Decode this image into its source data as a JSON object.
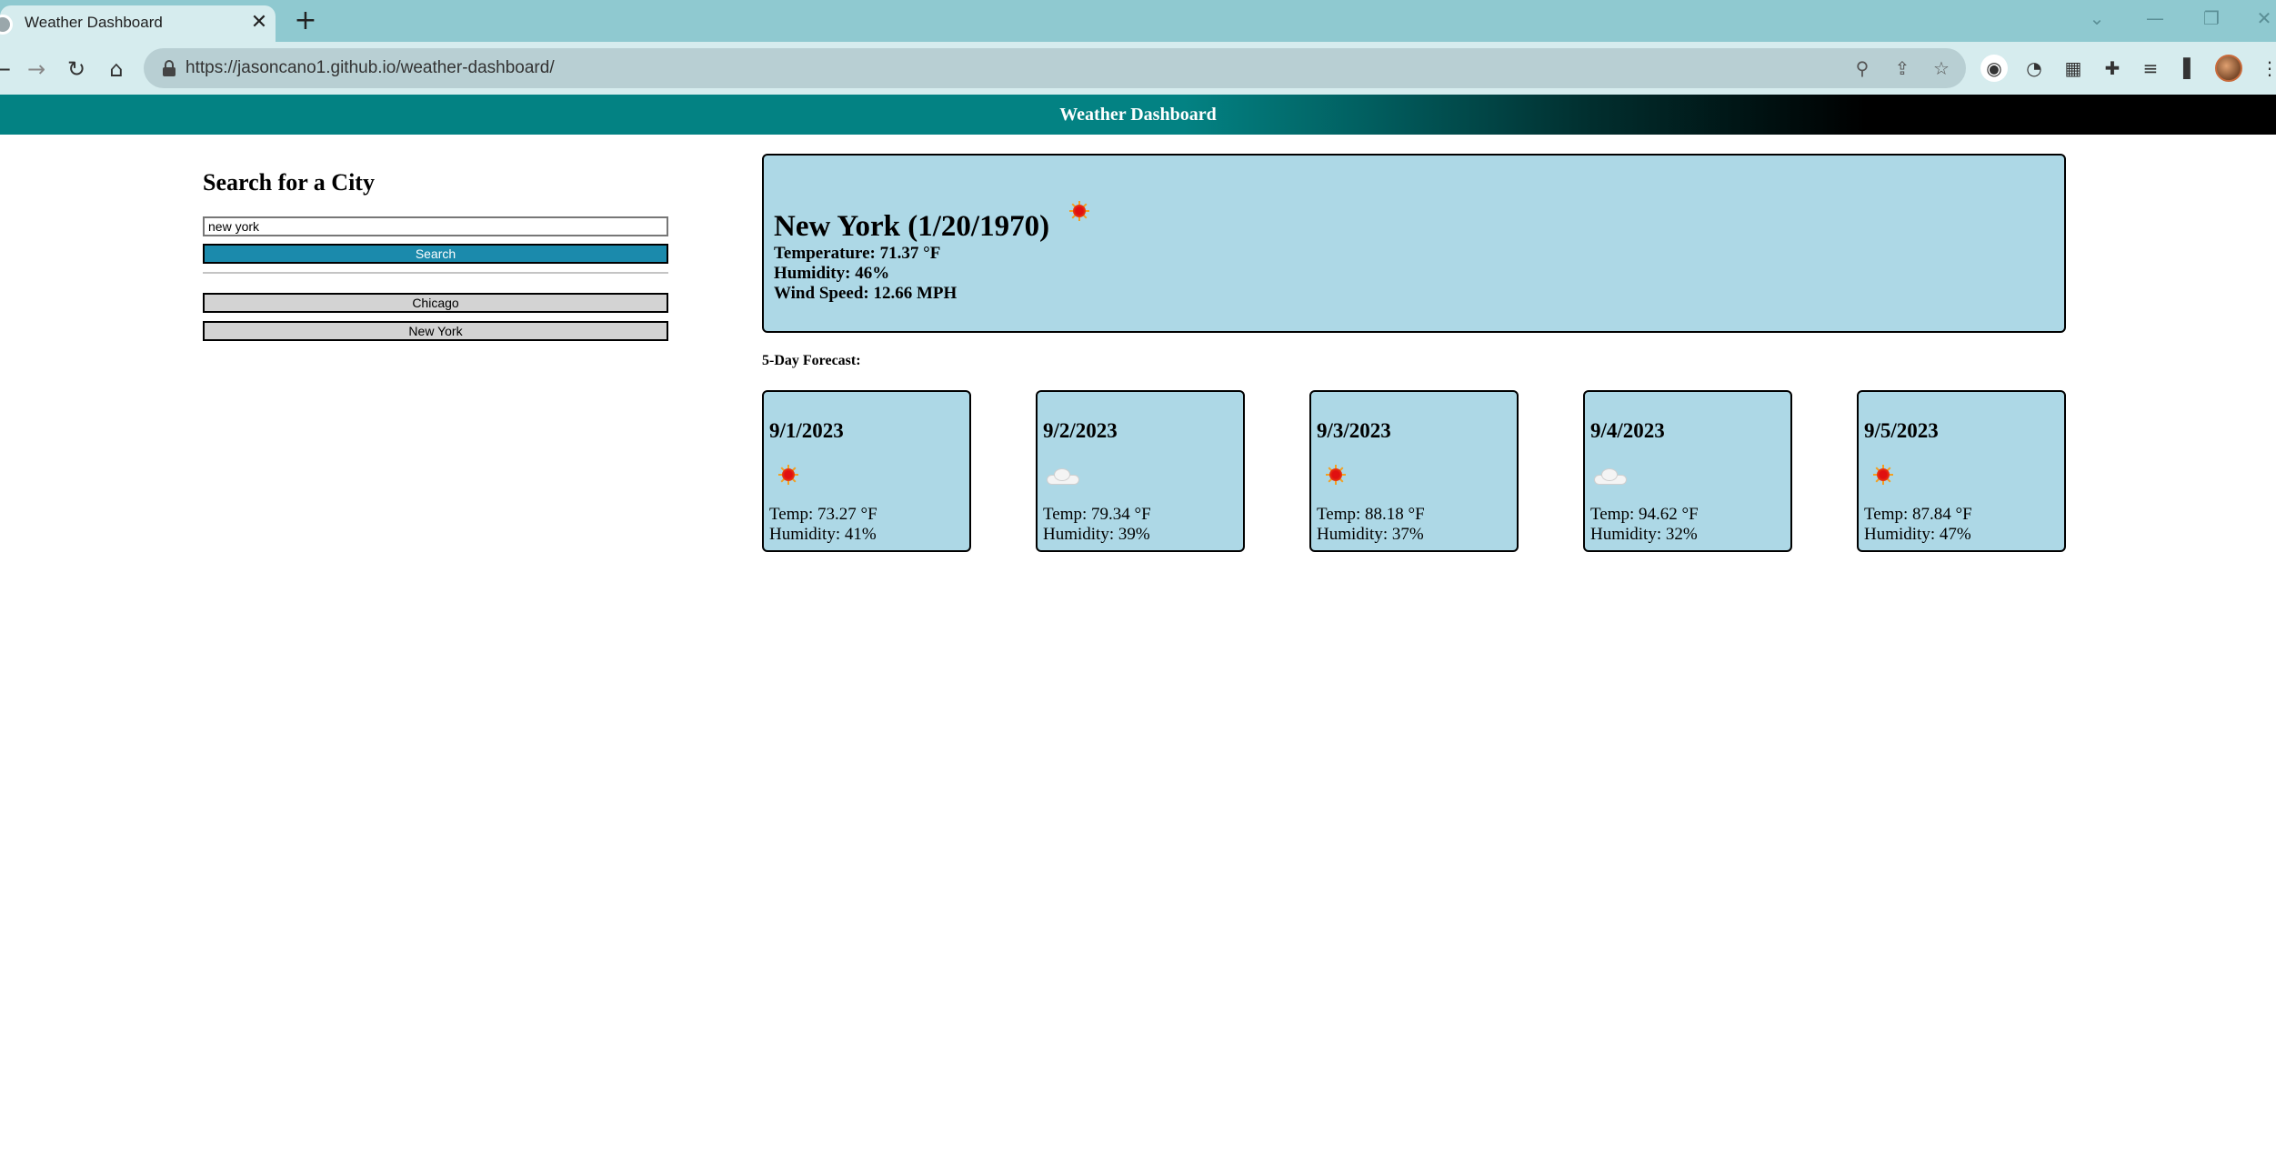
{
  "browser": {
    "tab_title": "Weather Dashboard",
    "tab_close": "✕",
    "new_tab": "+",
    "url": "https://jasoncano1.github.io/weather-dashboard/"
  },
  "header": {
    "title": "Weather Dashboard"
  },
  "sidebar": {
    "heading": "Search for a City",
    "search_value": "new york",
    "search_button": "Search",
    "history": [
      "Chicago",
      "New York"
    ]
  },
  "current": {
    "title": "New York (1/20/1970)",
    "icon": "sun-icon",
    "temperature": "Temperature: 71.37 °F",
    "humidity": "Humidity: 46%",
    "wind": "Wind Speed: 12.66 MPH"
  },
  "forecast": {
    "label": "5-Day Forecast:",
    "days": [
      {
        "date": "9/1/2023",
        "icon": "sun-icon",
        "temp": "Temp: 73.27 °F",
        "humidity": "Humidity: 41%"
      },
      {
        "date": "9/2/2023",
        "icon": "cloud-icon",
        "temp": "Temp: 79.34 °F",
        "humidity": "Humidity: 39%"
      },
      {
        "date": "9/3/2023",
        "icon": "sun-icon",
        "temp": "Temp: 88.18 °F",
        "humidity": "Humidity: 37%"
      },
      {
        "date": "9/4/2023",
        "icon": "cloud-icon",
        "temp": "Temp: 94.62 °F",
        "humidity": "Humidity: 32%"
      },
      {
        "date": "9/5/2023",
        "icon": "sun-icon",
        "temp": "Temp: 87.84 °F",
        "humidity": "Humidity: 47%"
      }
    ]
  },
  "colors": {
    "header_start": "#038283",
    "header_end": "#000000",
    "card_bg": "#add8e6",
    "search_button_bg": "#1b8aac",
    "history_button_bg": "#d3d3d3"
  }
}
